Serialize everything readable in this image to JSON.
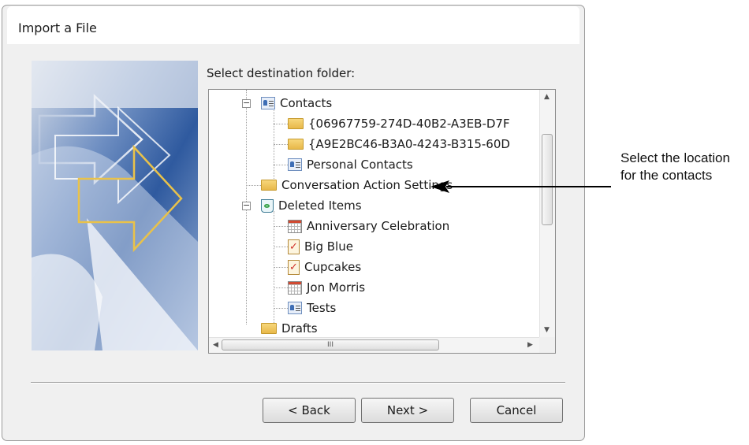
{
  "dialog": {
    "title": "Import a File",
    "prompt": "Select destination folder:"
  },
  "tree": {
    "items": [
      {
        "label": "Contacts",
        "icon": "contacts-icon",
        "expanded": true
      },
      {
        "label": "{06967759-274D-40B2-A3EB-D7F",
        "icon": "folder-icon"
      },
      {
        "label": "{A9E2BC46-B3A0-4243-B315-60D",
        "icon": "folder-icon"
      },
      {
        "label": "Personal Contacts",
        "icon": "contacts-icon"
      },
      {
        "label": "Conversation Action Settings",
        "icon": "folder-icon"
      },
      {
        "label": "Deleted Items",
        "icon": "trash-icon",
        "expanded": true
      },
      {
        "label": "Anniversary Celebration",
        "icon": "calendar-icon"
      },
      {
        "label": "Big Blue",
        "icon": "task-icon"
      },
      {
        "label": "Cupcakes",
        "icon": "task-icon"
      },
      {
        "label": "Jon Morris",
        "icon": "calendar-icon"
      },
      {
        "label": "Tests",
        "icon": "contacts-icon"
      },
      {
        "label": "Drafts",
        "icon": "folder-icon"
      }
    ],
    "toggle_minus": "−",
    "hscroll_grip": "III"
  },
  "buttons": {
    "back": "< Back",
    "next": "Next >",
    "cancel": "Cancel"
  },
  "annotation": {
    "line1": "Select the location",
    "line2": "for the contacts"
  }
}
